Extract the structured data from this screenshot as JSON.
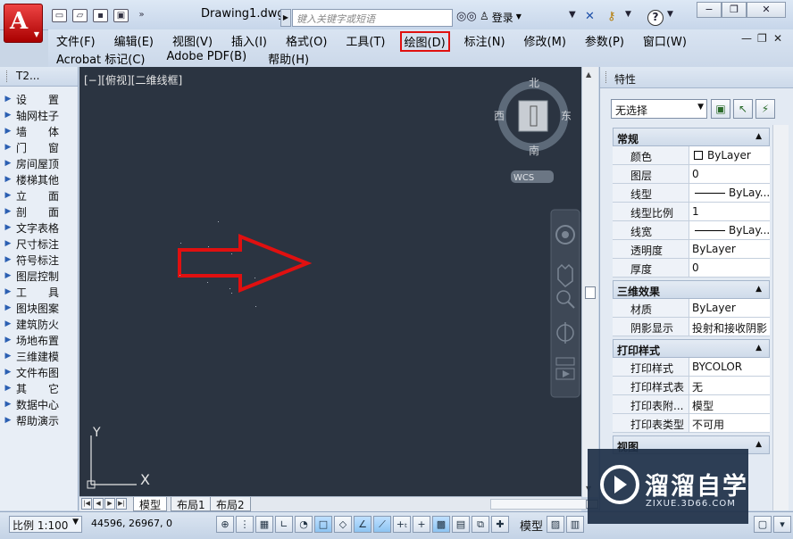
{
  "app": {
    "document_title": "Drawing1.dwg",
    "search_placeholder": "键入关键字或短语",
    "login_label": "登录"
  },
  "menus": {
    "row1": [
      "文件(F)",
      "编辑(E)",
      "视图(V)",
      "插入(I)",
      "格式(O)",
      "工具(T)",
      "绘图(D)",
      "标注(N)",
      "修改(M)",
      "参数(P)",
      "窗口(W)"
    ],
    "row2": [
      "Acrobat 标记(C)",
      "Adobe PDF(B)",
      "帮助(H)"
    ],
    "highlighted": "绘图(D)",
    "highlight_color": "#e01010"
  },
  "left_panel": {
    "title": "T2...",
    "items": [
      "设　　置",
      "轴网柱子",
      "墙　　体",
      "门　　窗",
      "房间屋顶",
      "楼梯其他",
      "立　　面",
      "剖　　面",
      "文字表格",
      "尺寸标注",
      "符号标注",
      "图层控制",
      "工　　具",
      "图块图案",
      "建筑防火",
      "场地布置",
      "三维建模",
      "文件布图",
      "其　　它",
      "数据中心",
      "帮助演示"
    ]
  },
  "viewport": {
    "label": "[−][俯视][二维线框]",
    "background": "#2b3441",
    "viewcube": {
      "north": "北",
      "south": "南",
      "east": "东",
      "west": "西",
      "ucs": "WCS"
    },
    "ucs_axes": {
      "x": "X",
      "y": "Y"
    },
    "arrow_color": "#e01010"
  },
  "layout_tabs": [
    "模型",
    "布局1",
    "布局2"
  ],
  "properties": {
    "title": "特性",
    "selection": "无选择",
    "sections": [
      {
        "name": "常规",
        "rows": [
          {
            "key": "颜色",
            "value": "ByLayer",
            "swatch": true
          },
          {
            "key": "图层",
            "value": "0"
          },
          {
            "key": "线型",
            "value": "ByLay...",
            "line": true
          },
          {
            "key": "线型比例",
            "value": "1"
          },
          {
            "key": "线宽",
            "value": "ByLay...",
            "line": true
          },
          {
            "key": "透明度",
            "value": "ByLayer"
          },
          {
            "key": "厚度",
            "value": "0"
          }
        ]
      },
      {
        "name": "三维效果",
        "rows": [
          {
            "key": "材质",
            "value": "ByLayer"
          },
          {
            "key": "阴影显示",
            "value": "投射和接收阴影"
          }
        ]
      },
      {
        "name": "打印样式",
        "rows": [
          {
            "key": "打印样式",
            "value": "BYCOLOR"
          },
          {
            "key": "打印样式表",
            "value": "无"
          },
          {
            "key": "打印表附...",
            "value": "模型"
          },
          {
            "key": "打印表类型",
            "value": "不可用"
          }
        ]
      },
      {
        "name": "视图",
        "rows": []
      }
    ]
  },
  "statusbar": {
    "scale": "比例 1:100",
    "coords": "44596, 26967, 0",
    "model_label": "模型"
  },
  "watermark": {
    "name": "溜溜自学",
    "url": "ZIXUE.3D66.COM"
  }
}
